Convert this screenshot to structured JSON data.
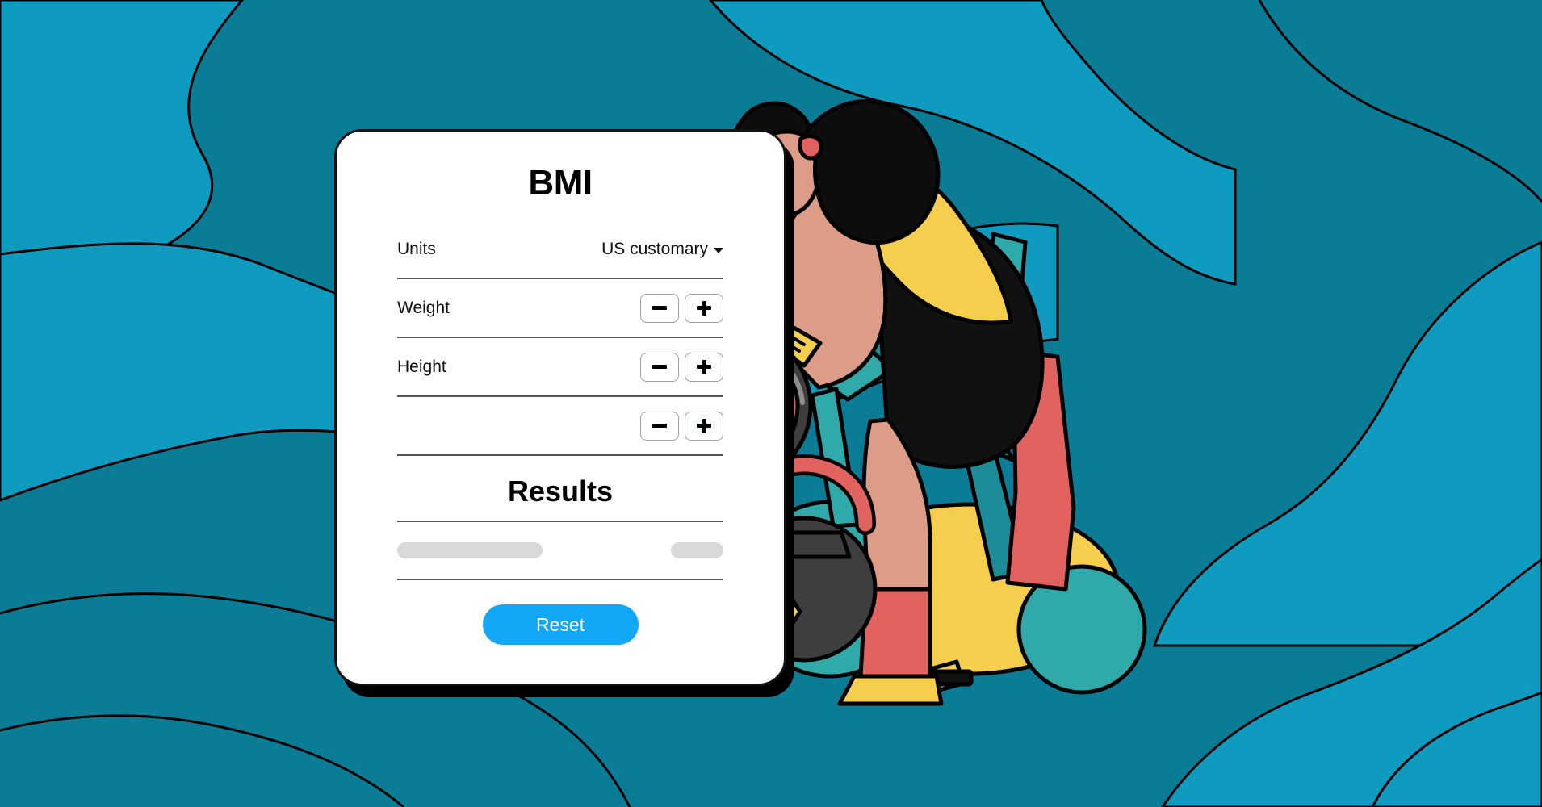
{
  "app": {
    "title": "BMI",
    "background_color": "#0A7C96",
    "background_color_light": "#0E9BBF"
  },
  "card": {
    "title": "BMI",
    "rows": [
      {
        "label": "Units",
        "control": "select",
        "value": "US customary"
      },
      {
        "label": "Weight",
        "control": "stepper",
        "minus": "−",
        "plus": "+"
      },
      {
        "label": "Height",
        "control": "stepper",
        "minus": "−",
        "plus": "+"
      },
      {
        "label": "",
        "control": "stepper",
        "minus": "−",
        "plus": "+"
      }
    ],
    "results": {
      "title": "Results",
      "placeholder_long": "",
      "placeholder_short": ""
    },
    "reset_label": "Reset"
  },
  "illustration": {
    "name": "woman-on-exercise-bike",
    "colors": {
      "skin": "#DD9C87",
      "hair": "#0D0D0D",
      "top": "#F5CE4E",
      "shorts": "#111111",
      "bike_frame": "#2FA9A9",
      "flywheel": "#F5CE4E",
      "accent_red": "#E2625F",
      "kettlebell": "#3E3E3E",
      "stopwatch_ring": "#E2625F"
    }
  }
}
